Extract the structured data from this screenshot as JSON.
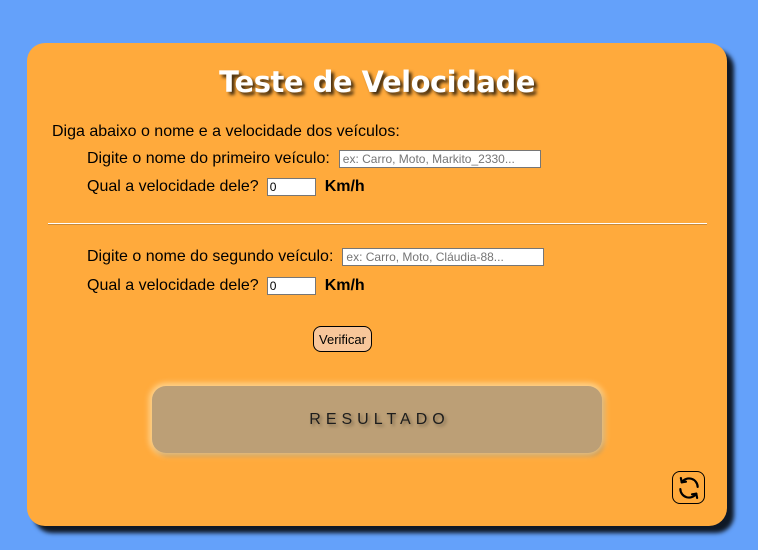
{
  "title": "Teste de Velocidade",
  "intro": "Diga abaixo o nome e a velocidade dos veículos:",
  "vehicle1": {
    "name_label": "Digite o nome do primeiro veículo:",
    "name_placeholder": "ex: Carro, Moto, Markito_2330...",
    "speed_label": "Qual a velocidade dele?",
    "speed_value": "0",
    "unit": "Km/h"
  },
  "vehicle2": {
    "name_label": "Digite o nome do segundo veículo:",
    "name_placeholder": "ex: Carro, Moto, Cláudia-88...",
    "speed_label": "Qual a velocidade dele?",
    "speed_value": "0",
    "unit": "Km/h"
  },
  "verify_label": "Verificar",
  "result_label": "RESULTADO",
  "icons": {
    "reload": "refresh-icon"
  },
  "colors": {
    "background": "#64a1fa",
    "card": "#ffaa3c",
    "result_box": "#bc9f76",
    "verify_button": "#f8c69a"
  }
}
